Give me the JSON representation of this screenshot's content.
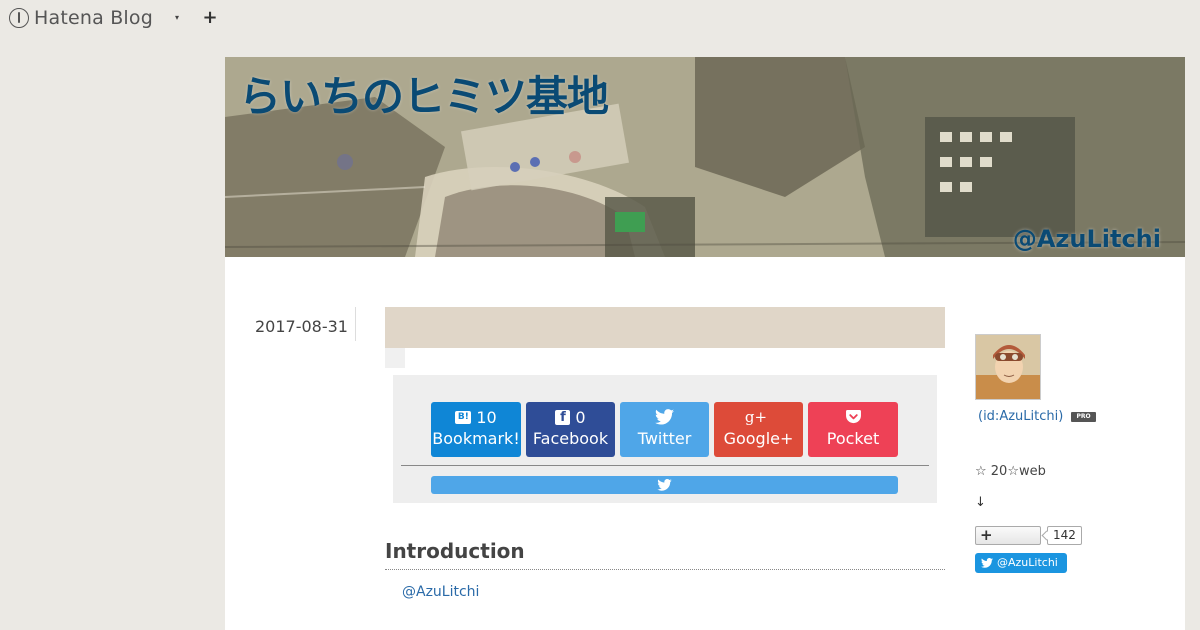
{
  "topbar": {
    "logo_text": "Hatena Blog",
    "dropdown_icon": "▾",
    "plus_icon": "+"
  },
  "banner": {
    "title": "らいちのヒミツ基地",
    "handle": "@AzuLitchi"
  },
  "article": {
    "date": "2017-08-31",
    "share_buttons": [
      {
        "name": "hatena-bookmark",
        "count": "10",
        "label": "Bookmark!",
        "icon": "B!"
      },
      {
        "name": "facebook",
        "count": "0",
        "label": "Facebook",
        "icon": "f"
      },
      {
        "name": "twitter",
        "count": "",
        "label": "Twitter",
        "icon": "twitter-bird"
      },
      {
        "name": "google-plus",
        "count": "",
        "label": "Google+",
        "icon": "g+"
      },
      {
        "name": "pocket",
        "count": "",
        "label": "Pocket",
        "icon": "pocket"
      }
    ],
    "intro_heading": "Introduction",
    "intro_link": "@AzuLitchi"
  },
  "sidebar": {
    "profile_id": "(id:AzuLitchi)",
    "pro_badge": "PRO",
    "stars_text": "☆ 20☆web",
    "arrow": "↓",
    "follow_plus": "+",
    "follow_count": "142",
    "twitter_follow": "@AzuLitchi"
  },
  "colors": {
    "background": "#ebe9e4",
    "title_bar": "#e0d6c8",
    "hatena": "#0f86d6",
    "facebook": "#2f4d97",
    "twitter": "#4fa6e8",
    "google": "#dd4b39",
    "pocket": "#ee4156",
    "link": "#2a6aa8"
  }
}
